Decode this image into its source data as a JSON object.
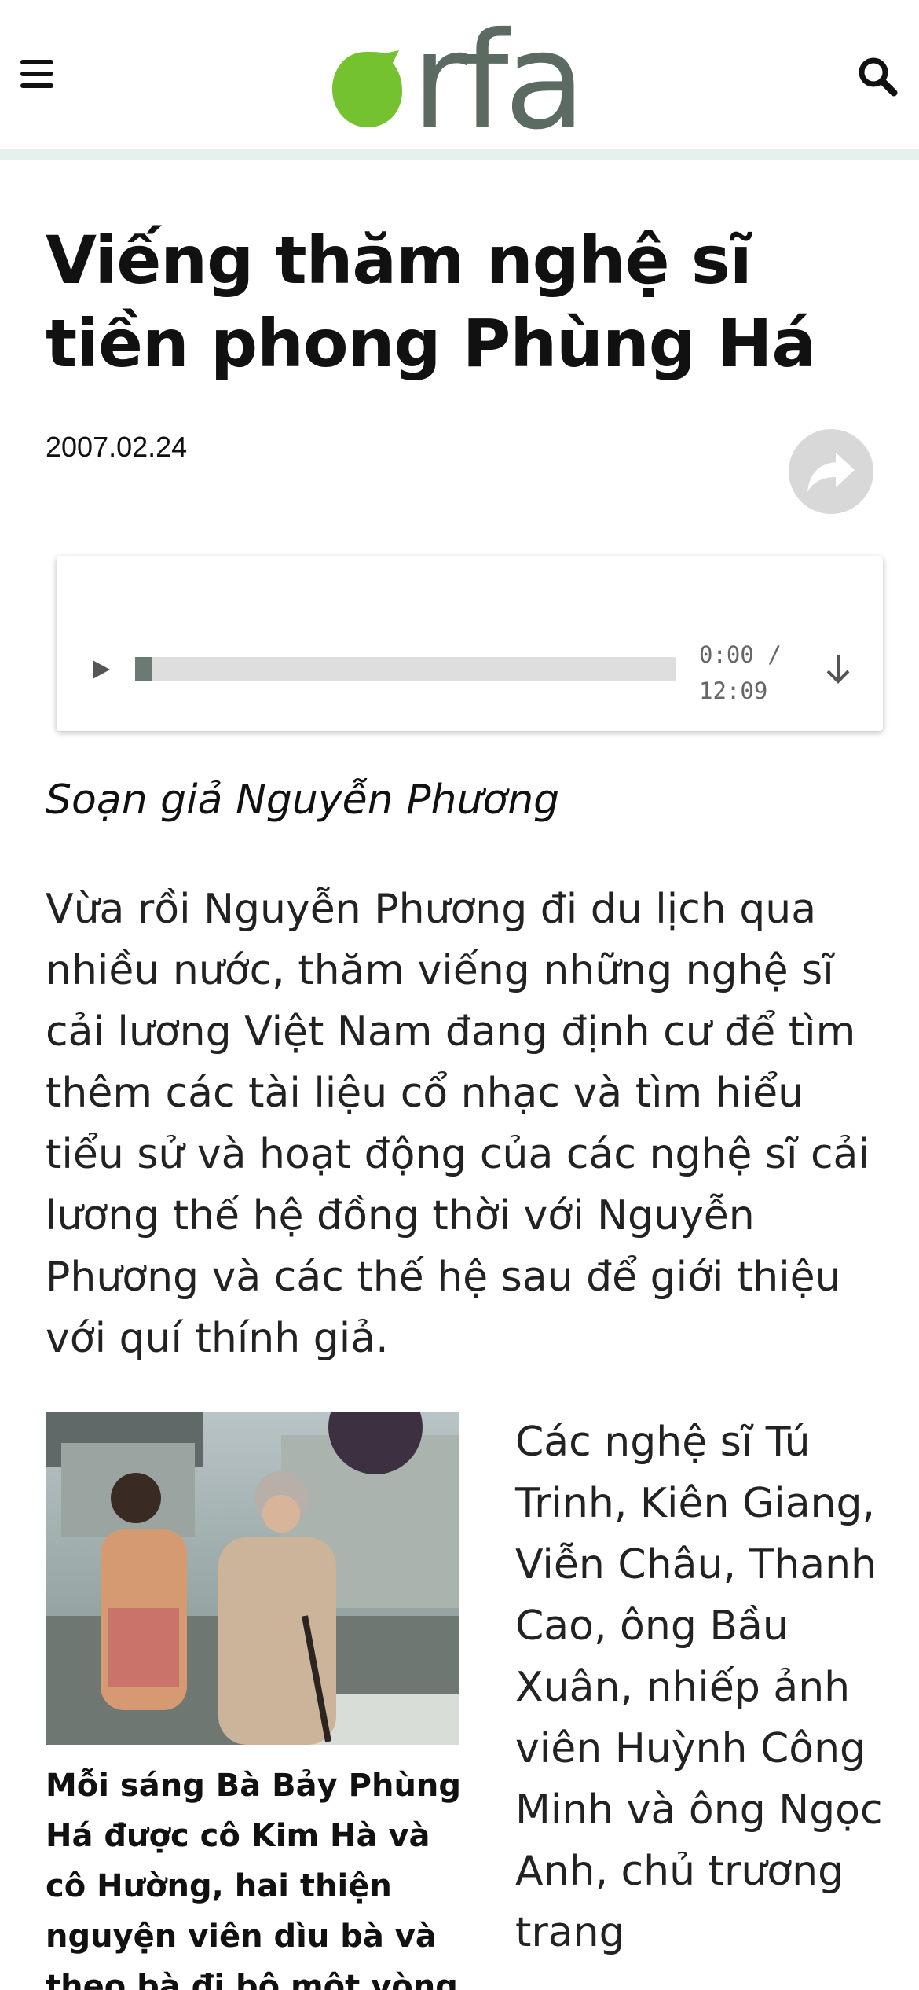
{
  "header": {
    "menu_icon": "hamburger-menu-icon",
    "logo_text": "rfa",
    "search_icon": "search-icon"
  },
  "colors": {
    "brand_green": "#74c22f",
    "logo_text": "#5c6b62",
    "header_bar": "#e6f0ec",
    "progress_fill": "#6b7a72"
  },
  "article": {
    "title": "Viếng thăm nghệ sĩ tiền phong Phùng Há",
    "date": "2007.02.24",
    "share_icon": "share-arrow-icon",
    "byline": "Soạn giả Nguyễn Phương",
    "lead": "Vừa rồi Nguyễn Phương đi du lịch qua nhiều nước, thăm viếng những nghệ sĩ cải lương Việt Nam đang định cư để tìm thêm các tài liệu cổ nhạc và tìm hiểu tiểu sử và hoạt động của các nghệ sĩ cải lương thế hệ đồng thời với Nguyễn Phương và các thế hệ sau để giới thiệu với quí thính giả.",
    "photo_caption": "Mỗi sáng Bà Bảy Phùng Há được cô Kim Hà và cô Hường, hai thiện nguyện viên dìu bà và theo bà đi bộ một vòng nhỏ trong",
    "side_text": "Các nghệ sĩ Tú Trinh, Kiên Giang, Viễn Châu, Thanh Cao, ông Bầu Xuân, nhiếp ảnh viên Huỳnh Công Minh và ông Ngọc Anh, chủ trương trang"
  },
  "player": {
    "play_icon": "play-icon",
    "download_icon": "download-icon",
    "current_time": "0:00",
    "separator": "/",
    "duration": "12:09",
    "progress_fraction": 0.03
  }
}
